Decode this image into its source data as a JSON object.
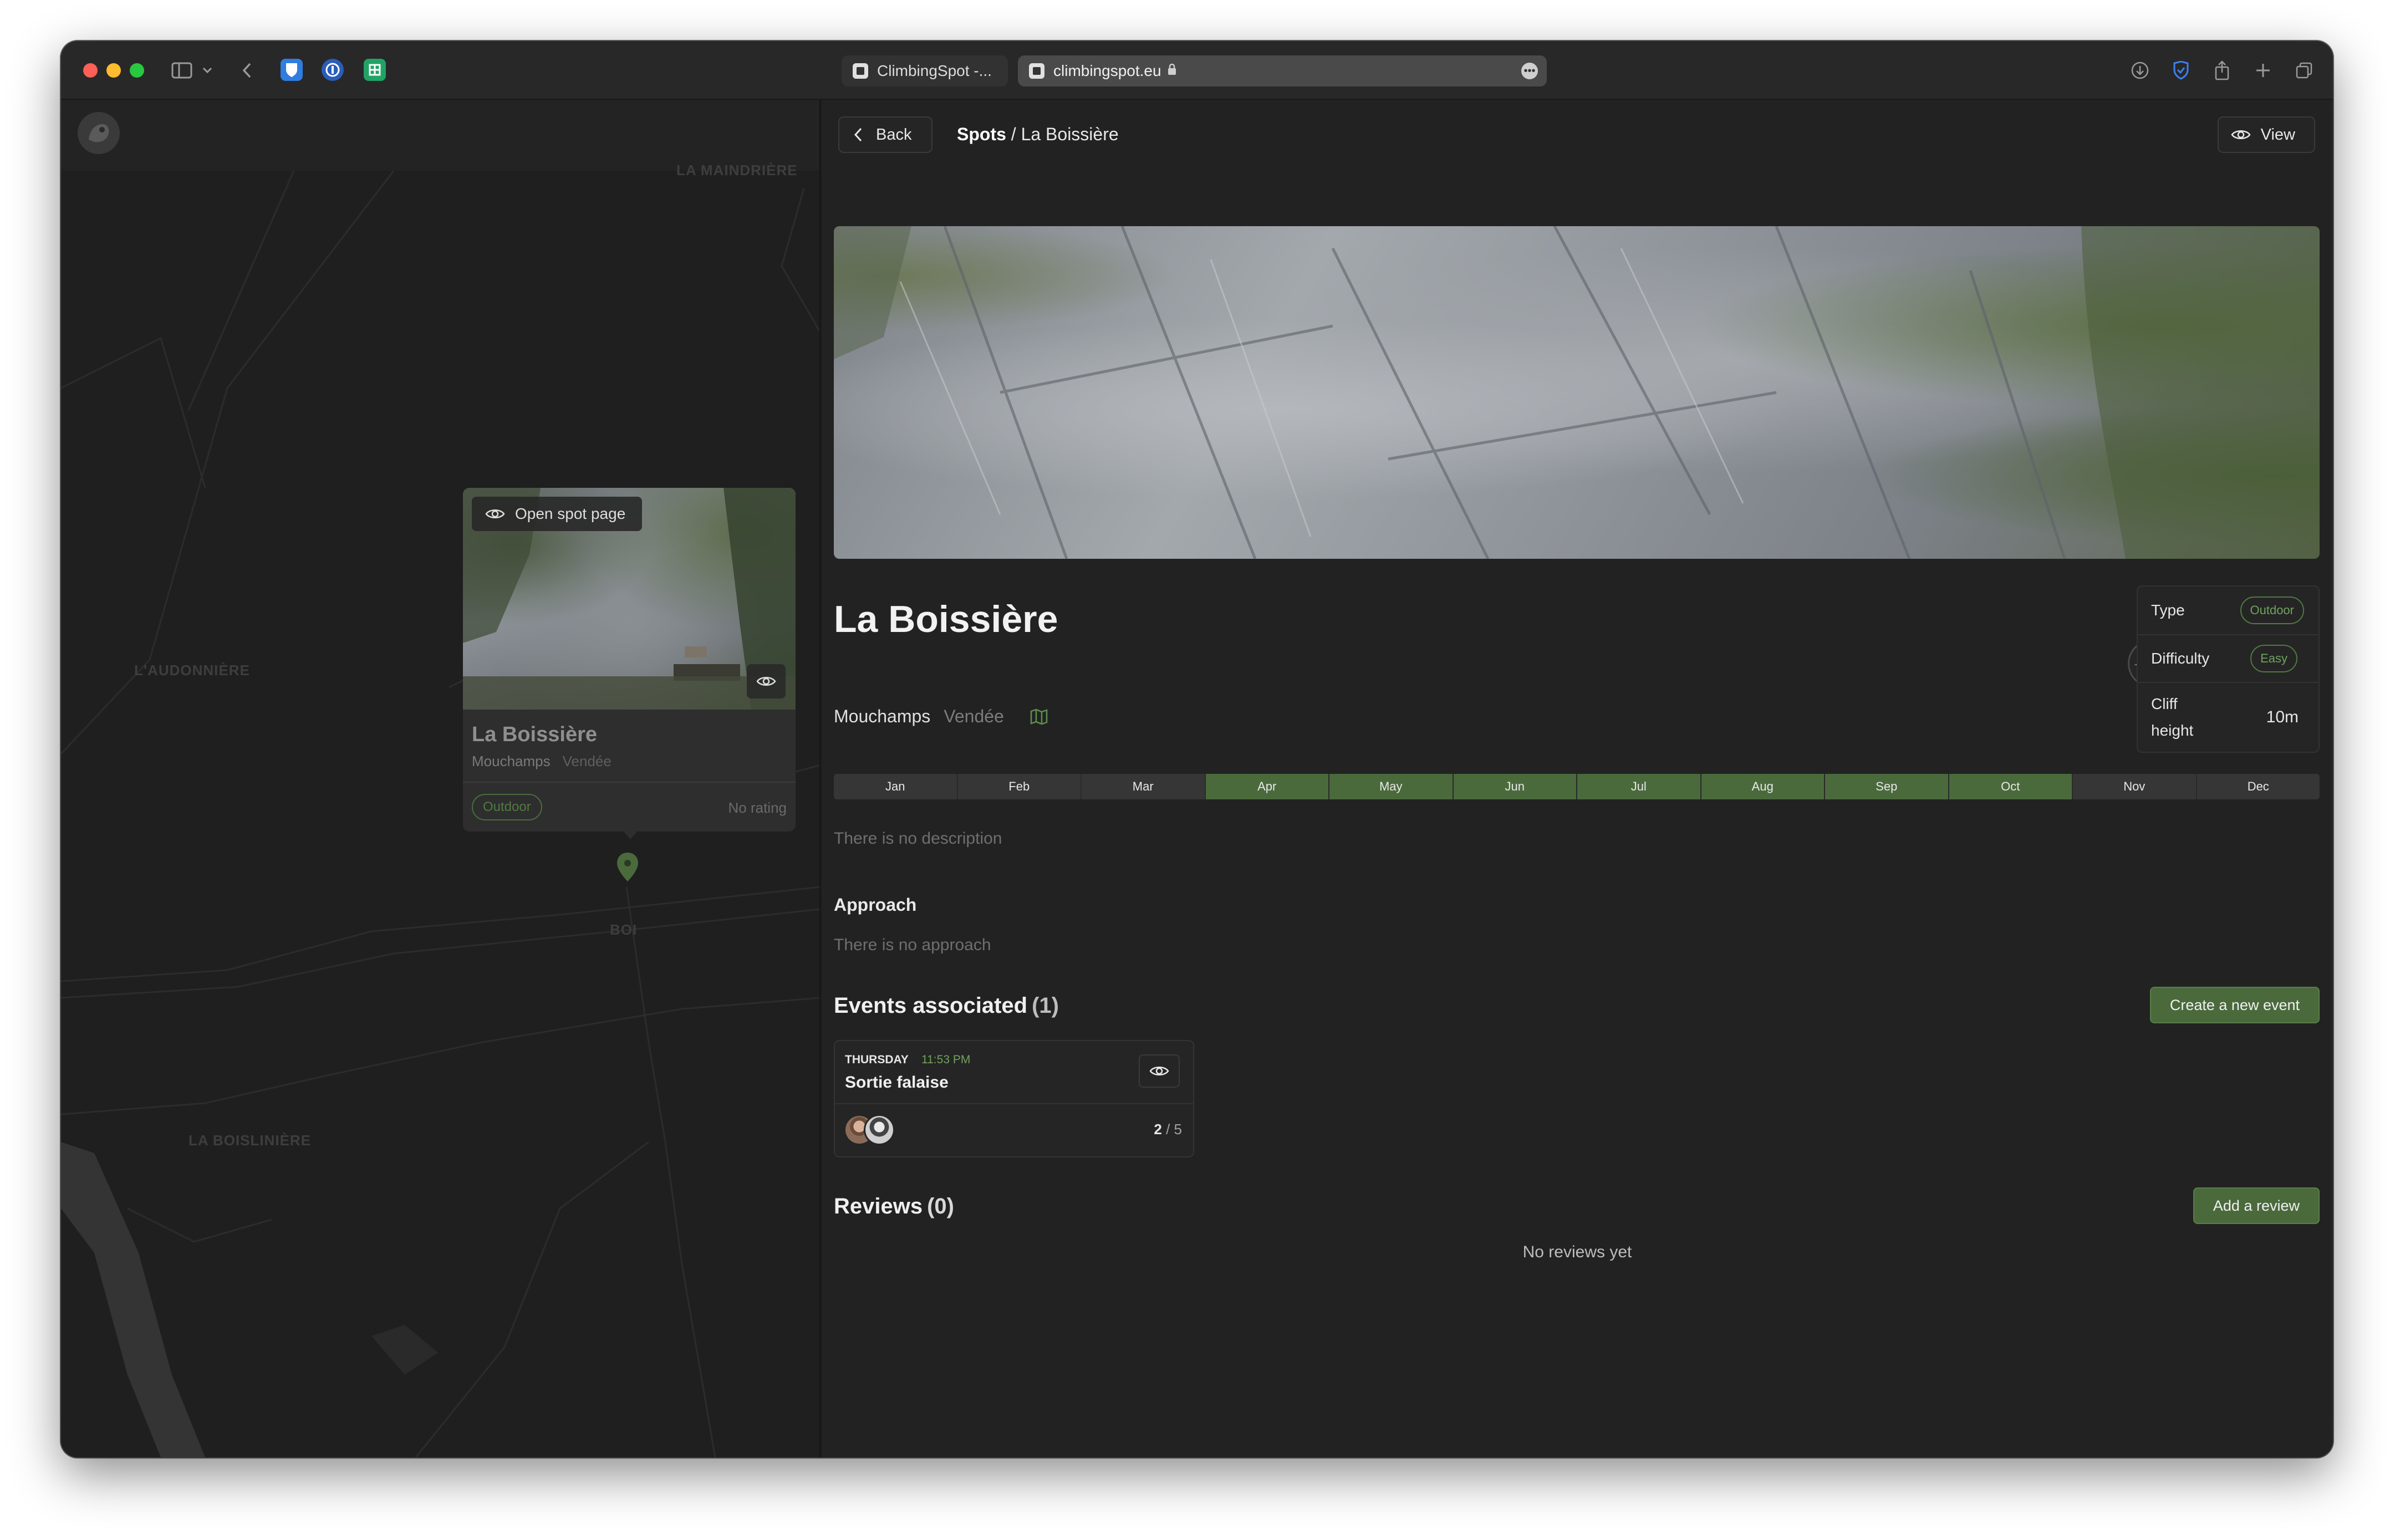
{
  "browser": {
    "tab_inactive_title": "ClimbingSpot -...",
    "tab_active_url": "climbingspot.eu"
  },
  "map": {
    "labels": [
      "LA MAINDRIÈRE",
      "L'AUDONNIÈRE",
      "BOI",
      "LA BOISLINIÈRE"
    ],
    "popup": {
      "open_label": "Open spot page",
      "title": "La Boissière",
      "city": "Mouchamps",
      "region": "Vendée",
      "type_badge": "Outdoor",
      "rating": "No rating"
    }
  },
  "header": {
    "back_label": "Back",
    "crumb_root": "Spots",
    "crumb_sep": " / ",
    "crumb_current": "La Boissière",
    "view_label": "View"
  },
  "spot": {
    "title": "La Boissière",
    "city": "Mouchamps",
    "region": "Vendée",
    "info": {
      "type_label": "Type",
      "type_value": "Outdoor",
      "difficulty_label": "Difficulty",
      "difficulty_value": "Easy",
      "height_label_1": "Cliff",
      "height_label_2": "height",
      "height_value": "10m"
    },
    "months": [
      {
        "label": "Jan",
        "active": false
      },
      {
        "label": "Feb",
        "active": false
      },
      {
        "label": "Mar",
        "active": false
      },
      {
        "label": "Apr",
        "active": true
      },
      {
        "label": "May",
        "active": true
      },
      {
        "label": "Jun",
        "active": true
      },
      {
        "label": "Jul",
        "active": true
      },
      {
        "label": "Aug",
        "active": true
      },
      {
        "label": "Sep",
        "active": true
      },
      {
        "label": "Oct",
        "active": true
      },
      {
        "label": "Nov",
        "active": false
      },
      {
        "label": "Dec",
        "active": false
      }
    ],
    "description": "There is no description",
    "approach_heading": "Approach",
    "approach_text": "There is no approach"
  },
  "events": {
    "heading": "Events associated",
    "count": "(1)",
    "create_label": "Create a new event",
    "items": [
      {
        "day": "THURSDAY",
        "time": "11:53 PM",
        "name": "Sortie falaise",
        "participants": "2",
        "max": "5"
      }
    ]
  },
  "reviews": {
    "heading": "Reviews",
    "count": "(0)",
    "add_label": "Add a review",
    "empty_text": "No reviews yet"
  },
  "colors": {
    "accent_green": "#4a6a3c",
    "badge_green": "#6fa35e",
    "background": "#222222"
  }
}
